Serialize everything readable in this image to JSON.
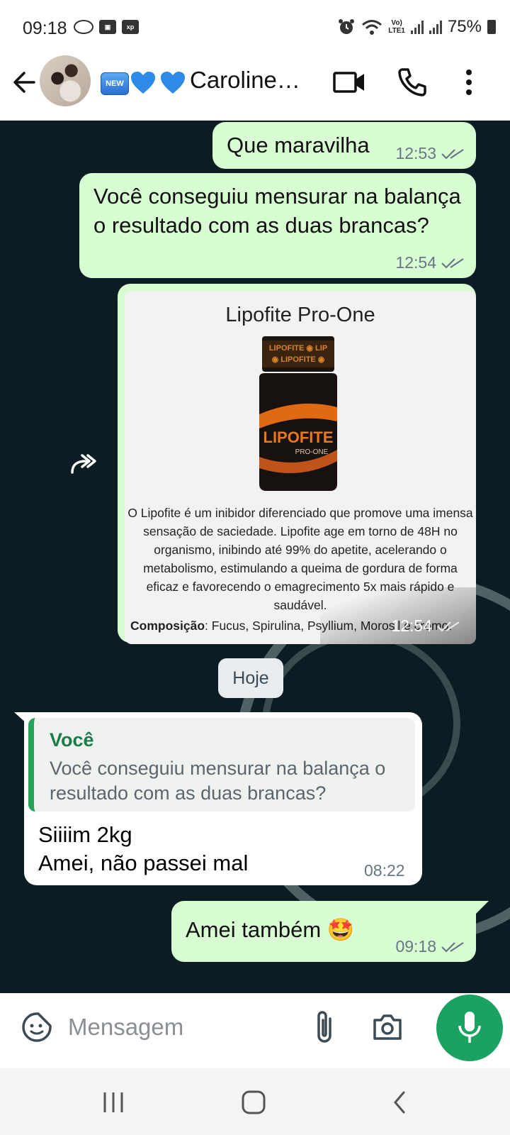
{
  "status": {
    "time": "09:18",
    "battery": "75%",
    "lte_label": "LTE1",
    "indicator_icons": [
      "eye-comfort-icon",
      "app-notification-icon",
      "xp-icon"
    ],
    "right_icons": [
      "alarm-icon",
      "wifi-icon",
      "volte-icon",
      "signal-icon",
      "signal-icon",
      "battery-icon"
    ]
  },
  "header": {
    "contact_name": "🆕💙💙Caroline…",
    "new_badge": "NEW",
    "icons": [
      "back-arrow-icon",
      "video-call-icon",
      "phone-icon",
      "more-vert-icon"
    ]
  },
  "messages": [
    {
      "text": "Que maravilha",
      "time": "12:53",
      "direction": "outgoing",
      "status": "read"
    },
    {
      "text": "Você conseguiu mensurar na balança o resultado com as duas brancas?",
      "time": "12:54",
      "direction": "outgoing",
      "status": "read"
    },
    {
      "type": "image",
      "time": "12:54",
      "direction": "outgoing",
      "forwarded": true,
      "card": {
        "title": "Lipofite Pro-One",
        "jar_brand": "LIPOFITE",
        "jar_sub": "PRO-ONE",
        "description": "O Lipofite é um inibidor diferenciado que promove uma imensa sensação de saciedade. Lipofite age em torno de 48H no organismo, inibindo até 99% do apetite, acelerando o metabolismo, estimulando a queima de gordura de forma eficaz e favorecendo o emagrecimento 5x mais rápido e saudável.",
        "composition_label": "Composição",
        "composition_text": ": Fucus, Spirulina, Psyllium, Morosil e cromo."
      }
    },
    {
      "type": "date",
      "text": "Hoje"
    },
    {
      "direction": "incoming",
      "quote_author": "Você",
      "quote_text": "Você conseguiu mensurar na balança o resultado com as duas brancas?",
      "line1": "Siiiim 2kg",
      "line2": "Amei, não passei mal",
      "time": "08:22"
    },
    {
      "text": "Amei também 🤩",
      "time": "09:18",
      "direction": "outgoing",
      "status": "read"
    }
  ],
  "composer": {
    "placeholder": "Mensagem",
    "icons": [
      "sticker-icon",
      "attach-icon",
      "camera-icon",
      "mic-icon"
    ]
  },
  "nav": {
    "icons": [
      "recent-apps-icon",
      "home-icon",
      "back-icon"
    ]
  },
  "colors": {
    "outgoing_bubble": "#d9fdd3",
    "incoming_bubble": "#ffffff",
    "chat_background": "#0b1c22",
    "accent_green": "#1aa260",
    "quote_bar": "#25a35a"
  }
}
